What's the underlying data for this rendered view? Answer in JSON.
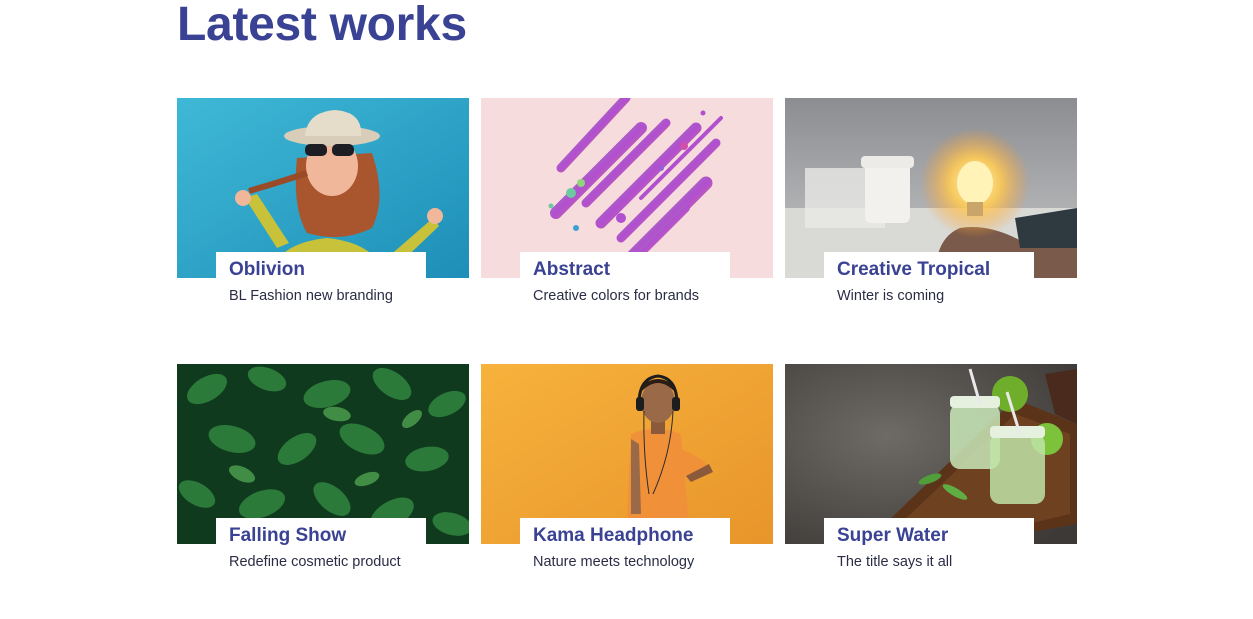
{
  "header": {
    "title": "Latest works"
  },
  "works": [
    {
      "title": "Oblivion",
      "subtitle": "BL Fashion new branding"
    },
    {
      "title": "Abstract",
      "subtitle": "Creative colors for brands"
    },
    {
      "title": "Creative Tropical",
      "subtitle": "Winter is coming"
    },
    {
      "title": "Falling Show",
      "subtitle": "Redefine cosmetic product"
    },
    {
      "title": "Kama Headphone",
      "subtitle": "Nature meets technology"
    },
    {
      "title": "Super Water",
      "subtitle": "The title says it all"
    }
  ],
  "colors": {
    "accent": "#3a4293",
    "text": "#2a2d45",
    "background": "#ffffff"
  }
}
